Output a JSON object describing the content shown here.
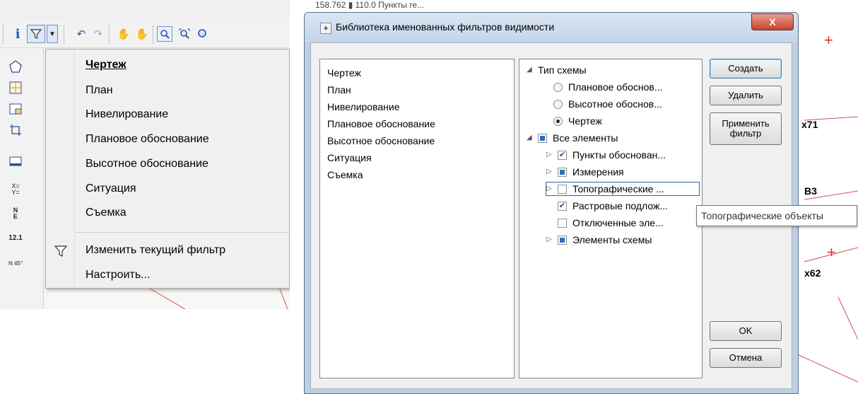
{
  "toolbar": {
    "icons": [
      "info-icon",
      "filter-icon",
      "dropdown-arrow-icon",
      "undo-icon",
      "redo-icon",
      "pan-hand-icon",
      "pan-hand-2-icon",
      "zoom-window-icon",
      "zoom-extents-icon",
      "zoom-icon"
    ],
    "vertical_icons": [
      "polygon-icon",
      "grid-cell-icon",
      "frame-icon",
      "crop-icon",
      "window-icon",
      "xy-coordinates-icon",
      "north-east-icon",
      "distance-icon",
      "azimuth-icon"
    ],
    "xy_glyph": "X=\nY=",
    "ne_glyph": "N\nE",
    "dist_glyph": "12.1",
    "az_glyph": "N 45°"
  },
  "menu": {
    "items": [
      "Чертеж",
      "План",
      "Нивелирование",
      "Плановое обоснование",
      "Высотное обоснование",
      "Ситуация",
      "Съемка"
    ],
    "actions": [
      "Изменить текущий фильтр",
      "Настроить..."
    ]
  },
  "background": {
    "top_snippet": "158.762 ▮ 110.0 Пункты ге...",
    "labels": [
      "x71",
      "B3",
      "x62"
    ]
  },
  "dialog": {
    "title": "Библиотека именованных фильтров видимости",
    "sysmenu": "+",
    "close": "X",
    "filters": [
      "Чертеж",
      "План",
      "Нивелирование",
      "Плановое обоснование",
      "Высотное обоснование",
      "Ситуация",
      "Съемка"
    ],
    "tree": {
      "schema_type": "Тип схемы",
      "radios": [
        "Плановое обоснов...",
        "Высотное обоснов...",
        "Чертеж"
      ],
      "all_elements": "Все элементы",
      "children": [
        "Пункты обоснован...",
        "Измерения",
        "Топографические ...",
        "Растровые подлож...",
        "Отключенные эле...",
        "Элементы схемы"
      ]
    },
    "buttons": {
      "create": "Создать",
      "delete": "Удалить",
      "apply": "Применить фильтр",
      "ok": "OK",
      "cancel": "Отмена"
    },
    "tooltip": "Топографические объекты"
  }
}
